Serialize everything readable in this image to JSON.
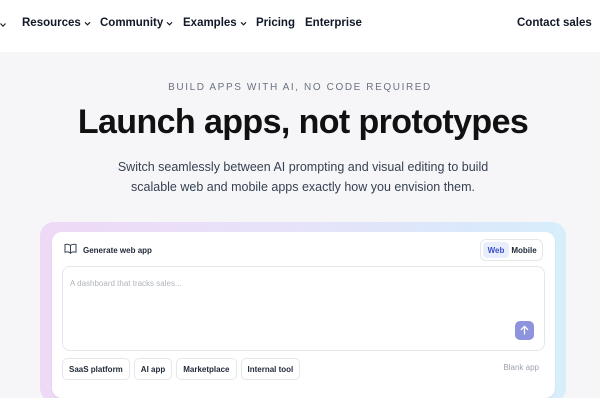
{
  "nav": {
    "items": [
      {
        "label": "Resources",
        "has_dropdown": true
      },
      {
        "label": "Community",
        "has_dropdown": true
      },
      {
        "label": "Examples",
        "has_dropdown": true
      },
      {
        "label": "Pricing",
        "has_dropdown": false
      },
      {
        "label": "Enterprise",
        "has_dropdown": false
      }
    ],
    "contact_label": "Contact sales"
  },
  "hero": {
    "eyebrow": "BUILD APPS WITH AI, NO CODE REQUIRED",
    "headline": "Launch apps, not prototypes",
    "subtitle": "Switch seamlessly between AI prompting and visual editing to build scalable web and mobile apps exactly how you envision them."
  },
  "builder": {
    "title": "Generate web app",
    "title_icon": "book-open-icon",
    "platform_options": [
      "Web",
      "Mobile"
    ],
    "selected_platform": "Web",
    "prompt": {
      "value": "",
      "placeholder": "A dashboard that tracks sales..."
    },
    "submit_icon": "arrow-up-icon",
    "chips": [
      "SaaS platform",
      "AI app",
      "Marketplace",
      "Internal tool"
    ],
    "blank_app_label": "Blank app"
  },
  "colors": {
    "accent": "#8d93dc",
    "toggle_active_bg": "#e9eefc",
    "toggle_active_text": "#3b4ecb",
    "page_bg": "#f6f6f9"
  }
}
